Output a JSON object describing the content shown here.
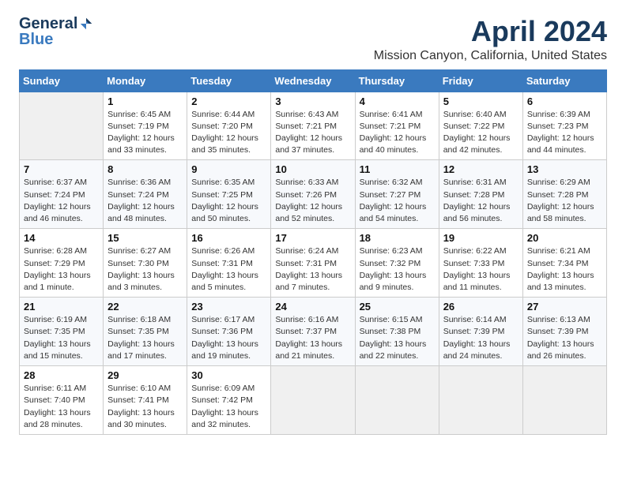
{
  "logo": {
    "general": "General",
    "blue": "Blue"
  },
  "header": {
    "month": "April 2024",
    "location": "Mission Canyon, California, United States"
  },
  "weekdays": [
    "Sunday",
    "Monday",
    "Tuesday",
    "Wednesday",
    "Thursday",
    "Friday",
    "Saturday"
  ],
  "weeks": [
    [
      {
        "day": "",
        "info": ""
      },
      {
        "day": "1",
        "info": "Sunrise: 6:45 AM\nSunset: 7:19 PM\nDaylight: 12 hours\nand 33 minutes."
      },
      {
        "day": "2",
        "info": "Sunrise: 6:44 AM\nSunset: 7:20 PM\nDaylight: 12 hours\nand 35 minutes."
      },
      {
        "day": "3",
        "info": "Sunrise: 6:43 AM\nSunset: 7:21 PM\nDaylight: 12 hours\nand 37 minutes."
      },
      {
        "day": "4",
        "info": "Sunrise: 6:41 AM\nSunset: 7:21 PM\nDaylight: 12 hours\nand 40 minutes."
      },
      {
        "day": "5",
        "info": "Sunrise: 6:40 AM\nSunset: 7:22 PM\nDaylight: 12 hours\nand 42 minutes."
      },
      {
        "day": "6",
        "info": "Sunrise: 6:39 AM\nSunset: 7:23 PM\nDaylight: 12 hours\nand 44 minutes."
      }
    ],
    [
      {
        "day": "7",
        "info": "Sunrise: 6:37 AM\nSunset: 7:24 PM\nDaylight: 12 hours\nand 46 minutes."
      },
      {
        "day": "8",
        "info": "Sunrise: 6:36 AM\nSunset: 7:24 PM\nDaylight: 12 hours\nand 48 minutes."
      },
      {
        "day": "9",
        "info": "Sunrise: 6:35 AM\nSunset: 7:25 PM\nDaylight: 12 hours\nand 50 minutes."
      },
      {
        "day": "10",
        "info": "Sunrise: 6:33 AM\nSunset: 7:26 PM\nDaylight: 12 hours\nand 52 minutes."
      },
      {
        "day": "11",
        "info": "Sunrise: 6:32 AM\nSunset: 7:27 PM\nDaylight: 12 hours\nand 54 minutes."
      },
      {
        "day": "12",
        "info": "Sunrise: 6:31 AM\nSunset: 7:28 PM\nDaylight: 12 hours\nand 56 minutes."
      },
      {
        "day": "13",
        "info": "Sunrise: 6:29 AM\nSunset: 7:28 PM\nDaylight: 12 hours\nand 58 minutes."
      }
    ],
    [
      {
        "day": "14",
        "info": "Sunrise: 6:28 AM\nSunset: 7:29 PM\nDaylight: 13 hours\nand 1 minute."
      },
      {
        "day": "15",
        "info": "Sunrise: 6:27 AM\nSunset: 7:30 PM\nDaylight: 13 hours\nand 3 minutes."
      },
      {
        "day": "16",
        "info": "Sunrise: 6:26 AM\nSunset: 7:31 PM\nDaylight: 13 hours\nand 5 minutes."
      },
      {
        "day": "17",
        "info": "Sunrise: 6:24 AM\nSunset: 7:31 PM\nDaylight: 13 hours\nand 7 minutes."
      },
      {
        "day": "18",
        "info": "Sunrise: 6:23 AM\nSunset: 7:32 PM\nDaylight: 13 hours\nand 9 minutes."
      },
      {
        "day": "19",
        "info": "Sunrise: 6:22 AM\nSunset: 7:33 PM\nDaylight: 13 hours\nand 11 minutes."
      },
      {
        "day": "20",
        "info": "Sunrise: 6:21 AM\nSunset: 7:34 PM\nDaylight: 13 hours\nand 13 minutes."
      }
    ],
    [
      {
        "day": "21",
        "info": "Sunrise: 6:19 AM\nSunset: 7:35 PM\nDaylight: 13 hours\nand 15 minutes."
      },
      {
        "day": "22",
        "info": "Sunrise: 6:18 AM\nSunset: 7:35 PM\nDaylight: 13 hours\nand 17 minutes."
      },
      {
        "day": "23",
        "info": "Sunrise: 6:17 AM\nSunset: 7:36 PM\nDaylight: 13 hours\nand 19 minutes."
      },
      {
        "day": "24",
        "info": "Sunrise: 6:16 AM\nSunset: 7:37 PM\nDaylight: 13 hours\nand 21 minutes."
      },
      {
        "day": "25",
        "info": "Sunrise: 6:15 AM\nSunset: 7:38 PM\nDaylight: 13 hours\nand 22 minutes."
      },
      {
        "day": "26",
        "info": "Sunrise: 6:14 AM\nSunset: 7:39 PM\nDaylight: 13 hours\nand 24 minutes."
      },
      {
        "day": "27",
        "info": "Sunrise: 6:13 AM\nSunset: 7:39 PM\nDaylight: 13 hours\nand 26 minutes."
      }
    ],
    [
      {
        "day": "28",
        "info": "Sunrise: 6:11 AM\nSunset: 7:40 PM\nDaylight: 13 hours\nand 28 minutes."
      },
      {
        "day": "29",
        "info": "Sunrise: 6:10 AM\nSunset: 7:41 PM\nDaylight: 13 hours\nand 30 minutes."
      },
      {
        "day": "30",
        "info": "Sunrise: 6:09 AM\nSunset: 7:42 PM\nDaylight: 13 hours\nand 32 minutes."
      },
      {
        "day": "",
        "info": ""
      },
      {
        "day": "",
        "info": ""
      },
      {
        "day": "",
        "info": ""
      },
      {
        "day": "",
        "info": ""
      }
    ]
  ]
}
